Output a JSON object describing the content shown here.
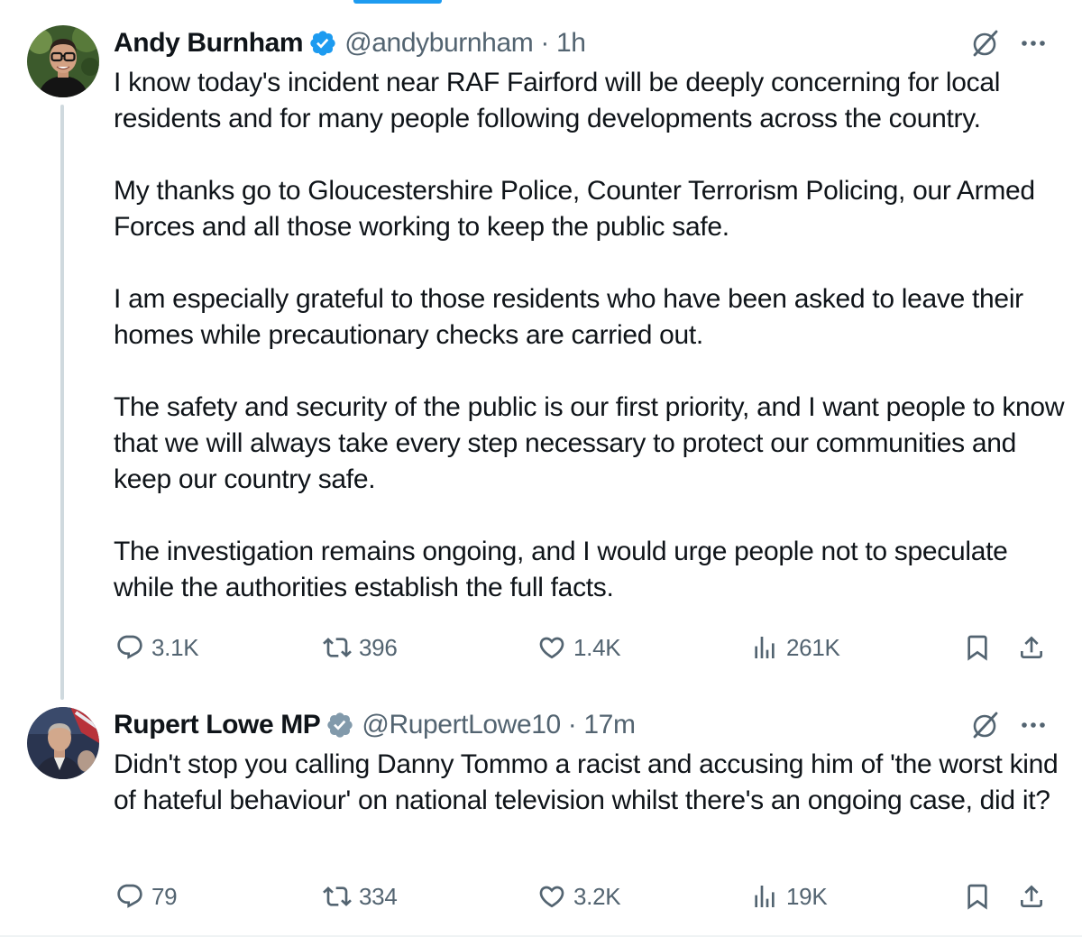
{
  "tweets": [
    {
      "author": {
        "name": "Andy Burnham",
        "handle": "@andyburnham",
        "verified": true
      },
      "separator": "·",
      "time": "1h",
      "paragraphs": [
        "I know today's incident near RAF Fairford will be deeply concerning for local residents and for many people following developments across the country.",
        "My thanks go to Gloucestershire Police, Counter Terrorism Policing, our Armed Forces and all those working to keep the public safe.",
        "I am especially grateful to those residents who have been asked to leave their homes while precautionary checks are carried out.",
        "The safety and security of the public is our first priority, and I want people to know that we will always take every step necessary to protect our communities and keep our country safe.",
        "The investigation remains ongoing, and I would urge people not to speculate while the authorities establish the full facts."
      ],
      "stats": {
        "replies": "3.1K",
        "reposts": "396",
        "likes": "1.4K",
        "views": "261K"
      }
    },
    {
      "author": {
        "name": "Rupert Lowe MP",
        "handle": "@RupertLowe10",
        "verified": true
      },
      "separator": "·",
      "time": "17m",
      "paragraphs": [
        "Didn't stop you calling Danny Tommo a racist and accusing him of 'the worst kind of hateful behaviour' on national television whilst there's an ongoing case, did it?"
      ],
      "stats": {
        "replies": "79",
        "reposts": "334",
        "likes": "3.2K",
        "views": "19K"
      }
    }
  ],
  "icons": {
    "reply": "speech-bubble-icon",
    "repost": "repost-arrows-icon",
    "like": "heart-outline-icon",
    "views": "bar-chart-icon",
    "bookmark": "bookmark-icon",
    "share": "share-upload-icon",
    "grok": "grok-slash-circle-icon",
    "more": "three-dots-icon",
    "verified": "blue-check-badge-icon"
  },
  "colors": {
    "text": "#0f1419",
    "secondary": "#536471",
    "blue_badge": "#1d9bf0",
    "gray_badge": "#829aab",
    "thread_line": "#cfd9de"
  }
}
